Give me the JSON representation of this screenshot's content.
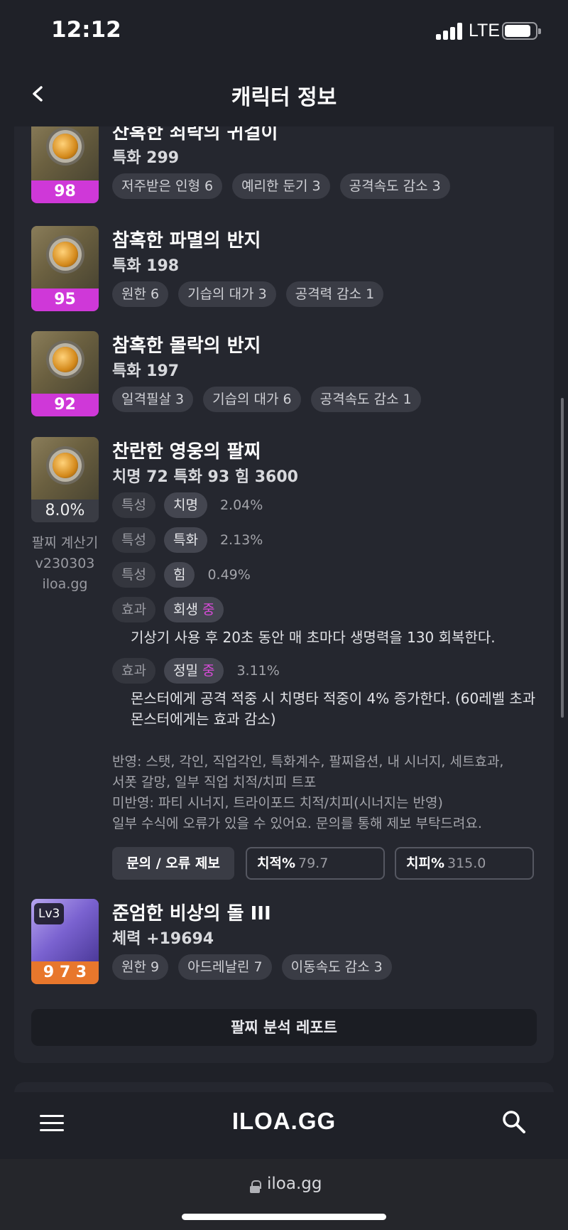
{
  "status": {
    "time": "12:12",
    "network": "LTE"
  },
  "header": {
    "title": "캐릭터 정보"
  },
  "items": [
    {
      "title": "잔혹한 쇠락의 귀걸이",
      "stat": "특화 299",
      "level": "98",
      "chips": [
        "저주받은 인형 6",
        "예리한 둔기 3",
        "공격속도 감소 3"
      ]
    },
    {
      "title": "참혹한 파멸의 반지",
      "stat": "특화 198",
      "level": "95",
      "chips": [
        "원한 6",
        "기습의 대가 3",
        "공격력 감소 1"
      ]
    },
    {
      "title": "참혹한 몰락의 반지",
      "stat": "특화 197",
      "level": "92",
      "chips": [
        "일격필살 3",
        "기습의 대가 6",
        "공격속도 감소 1"
      ]
    }
  ],
  "bracelet": {
    "title": "찬란한 영웅의 팔찌",
    "stat": "치명 72  특화 93  힘 3600",
    "percent": "8.0%",
    "calc": {
      "line1": "팔찌 계산기",
      "line2": "v230303",
      "line3": "iloa.gg"
    },
    "traits": [
      {
        "tag": "특성",
        "name": "치명",
        "value": "2.04%"
      },
      {
        "tag": "특성",
        "name": "특화",
        "value": "2.13%"
      },
      {
        "tag": "특성",
        "name": "힘",
        "value": "0.49%"
      }
    ],
    "effects": [
      {
        "tag": "효과",
        "name": "회생",
        "grade": "중",
        "value": "",
        "desc": "기상기 사용 후 20초 동안 매 초마다 생명력을 130 회복한다."
      },
      {
        "tag": "효과",
        "name": "정밀",
        "grade": "중",
        "value": "3.11%",
        "desc": "몬스터에게 공격 적중 시 치명타 적중이 4% 증가한다. (60레벨 초과 몬스터에게는 효과 감소)"
      }
    ],
    "notes": {
      "line1": "반영: 스탯, 각인, 직업각인, 특화계수, 팔찌옵션, 내 시너지, 세트효과,",
      "line2": "서폿 갈망, 일부 직업 치적/치피 트포",
      "line3": "미반영: 파티 시너지, 트라이포드 치적/치피(시너지는 반영)",
      "line4": "일부 수식에 오류가 있을 수 있어요. 문의를 통해 제보 부탁드려요."
    },
    "report_button": "문의 / 오류 제보",
    "crit_rate": {
      "label": "치적%",
      "value": "79.7"
    },
    "crit_dmg": {
      "label": "치피%",
      "value": "315.0"
    }
  },
  "stone": {
    "title": "준엄한 비상의 돌 III",
    "stat": "체력 +19694",
    "level_badge": "Lv3",
    "label": "9 7 3",
    "chips": [
      "원한 9",
      "아드레날린 7",
      "이동속도 감소 3"
    ]
  },
  "analysis_button": "팔찌 분석 레포트",
  "nav": {
    "logo": "ILOA.GG"
  },
  "url": "iloa.gg"
}
